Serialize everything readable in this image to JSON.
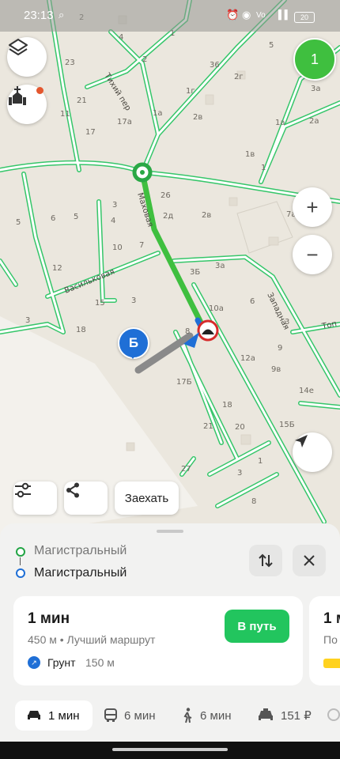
{
  "status_bar": {
    "time": "23:13",
    "battery": "20"
  },
  "map": {
    "streets": {
      "mahovaya": "Маховая",
      "vasilkovaya": "Васильковая",
      "zapadnaya": "Западная",
      "tihiy": "Тихий пер",
      "top": "Топ"
    },
    "house_numbers": [
      "2",
      "4",
      "1",
      "2",
      "23",
      "36",
      "2г",
      "5",
      "21",
      "1г",
      "3а",
      "17а",
      "1а",
      "2в",
      "1а",
      "2а",
      "11",
      "17",
      "1в",
      "1",
      "26",
      "3",
      "2д",
      "2в",
      "7а",
      "5",
      "6",
      "5",
      "4",
      "10",
      "7",
      "12",
      "3Б",
      "3а",
      "15",
      "3",
      "10а",
      "6",
      "3",
      "18",
      "8",
      "9",
      "17Б",
      "12а",
      "9в",
      "14е",
      "18",
      "15Б",
      "21",
      "20",
      "1",
      "27",
      "3",
      "8"
    ],
    "point_b_label": "Б",
    "zoom_in": "+",
    "zoom_out": "−"
  },
  "notification_badge": "1",
  "toolbar": {
    "drive_in_label": "Заехать"
  },
  "route": {
    "from": "Магистральный",
    "to": "Магистральный",
    "from_color": "#22a545",
    "to_color": "#1f6fd6"
  },
  "card_main": {
    "duration": "1 мин",
    "details": "450 м • Лучший маршрут",
    "surface_label": "Грунт",
    "surface_distance": "150 м",
    "go_label": "В путь"
  },
  "card_peek": {
    "duration": "1 м",
    "details": "По"
  },
  "transport_tabs": [
    {
      "label": "1 мин",
      "icon": "car"
    },
    {
      "label": "6 мин",
      "icon": "bus"
    },
    {
      "label": "6 мин",
      "icon": "walk"
    },
    {
      "label": "151 ₽",
      "icon": "taxi"
    }
  ],
  "colors": {
    "accent_green": "#22c55e",
    "route_green": "#3fbf3f",
    "road_green": "#36c66a",
    "blue": "#1f6fd6"
  }
}
